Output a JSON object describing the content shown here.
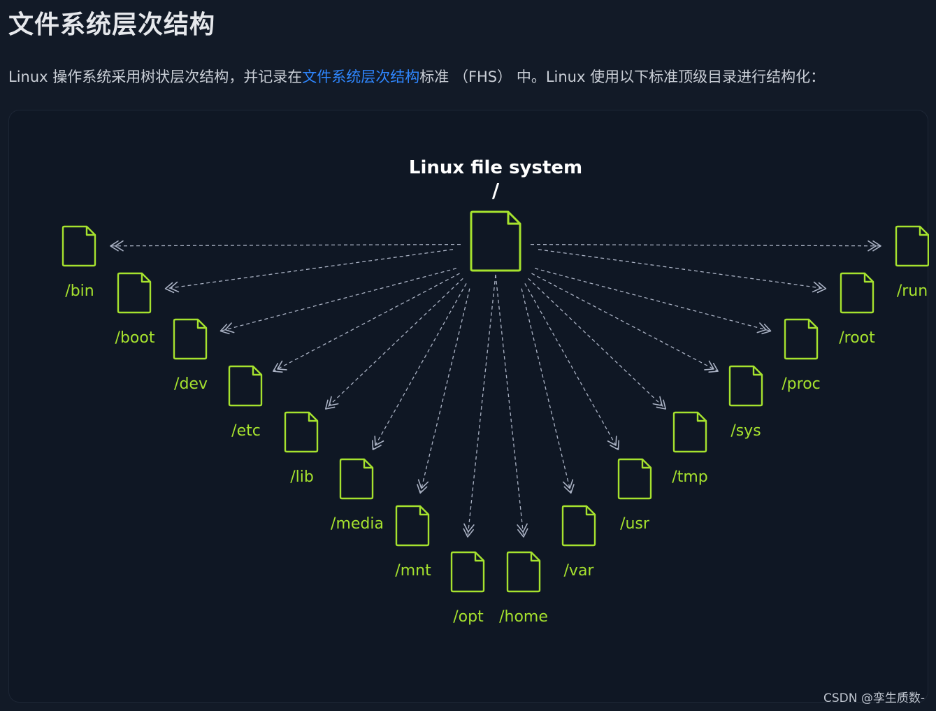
{
  "heading": "文件系统层次结构",
  "intro": {
    "before": "Linux 操作系统采用树状层次结构，并记录在",
    "link": "文件系统层次结构",
    "after": "标准 （FHS） 中。Linux 使用以下标准顶级目录进行结构化："
  },
  "diagram": {
    "title": "Linux file system",
    "root_label": "/",
    "directories": [
      "/bin",
      "/boot",
      "/dev",
      "/etc",
      "/lib",
      "/media",
      "/mnt",
      "/opt",
      "/home",
      "/var",
      "/usr",
      "/tmp",
      "/sys",
      "/proc",
      "/root",
      "/run"
    ],
    "colors": {
      "accent": "#a6e22e",
      "arrow": "#aab2c4",
      "title": "#ffffff"
    },
    "icon": "file-icon"
  },
  "watermark": "CSDN @孪生质数-"
}
